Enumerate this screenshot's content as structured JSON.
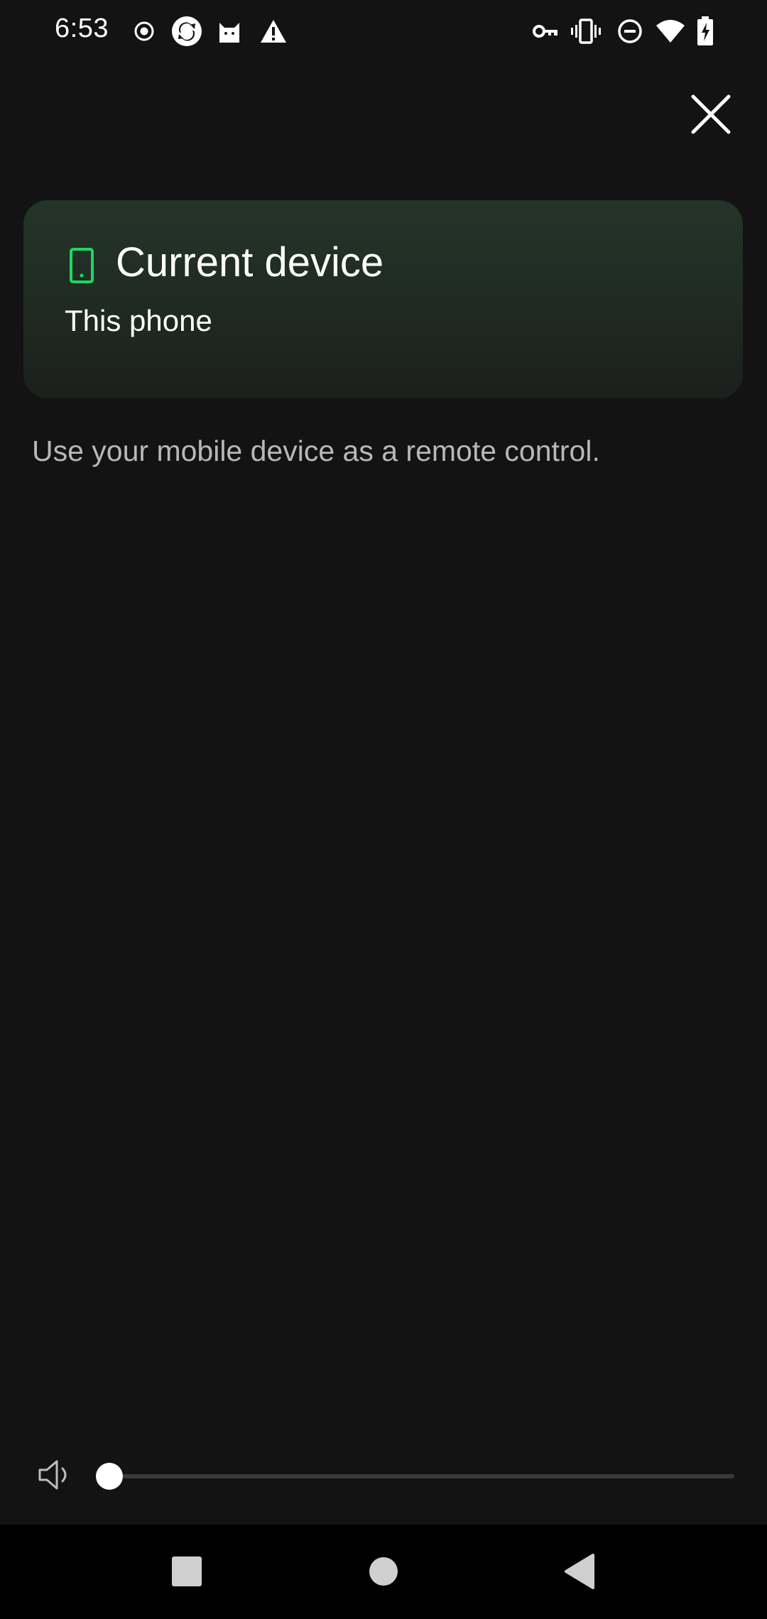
{
  "status_bar": {
    "time": "6:53",
    "left_icons": [
      "record-icon",
      "sync-icon",
      "cat-icon",
      "warning-icon"
    ],
    "right_icons": [
      "vpn-key-icon",
      "vibrate-icon",
      "do-not-disturb-icon",
      "wifi-icon",
      "battery-charging-icon"
    ]
  },
  "header": {
    "close_icon": "close-icon"
  },
  "current_device": {
    "title": "Current device",
    "subtitle": "This phone",
    "icon": "phone-icon",
    "accent_color": "#1ed760"
  },
  "hint_text": "Use your mobile device as a remote control.",
  "volume": {
    "icon": "speaker-icon",
    "level": 0.0
  },
  "nav_bar": {
    "buttons": [
      "recents-square-icon",
      "home-circle-icon",
      "back-triangle-icon"
    ]
  }
}
